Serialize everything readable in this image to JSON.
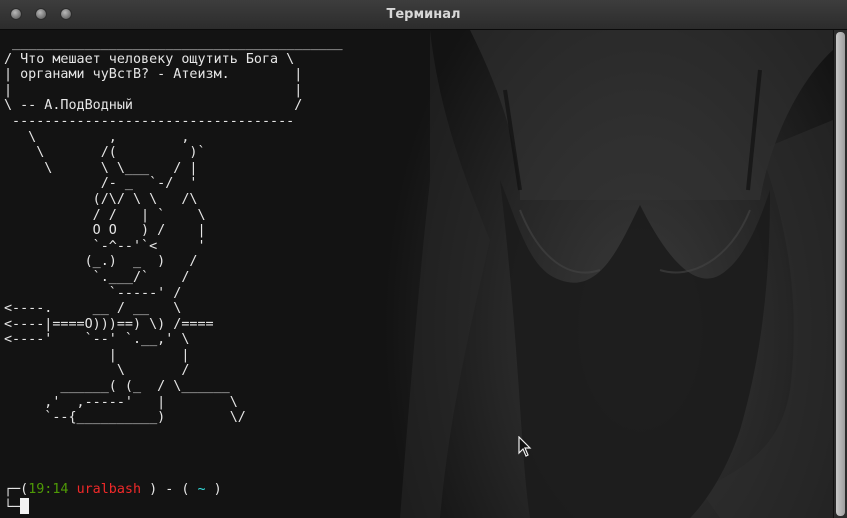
{
  "window": {
    "title": "Терминал",
    "buttons": [
      "close",
      "minimize",
      "maximize"
    ]
  },
  "terminal": {
    "output": " _________________________________________\n/ Что мешает человеку ощутить Бога \\\n| органами чуВстВ? - Атеизм.        |\n|                                   |\n\\ -- А.ПодВодный                    /\n -----------------------------------\n   \\         ,        ,\n    \\       /(         )`\n     \\      \\ \\___   / |\n            /- _  `-/  '\n           (/\\/ \\ \\   /\\\n           / /   | `    \\\n           O O   ) /    |\n           `-^--'`<     '\n          (_.)  _  )   /\n           `.___/`    /\n             `-----' /\n<----.     __ / __   \\\n<----|====O)))==) \\) /====\n<----'    `--' `.__,' \\\n             |        |\n              \\       /\n       ______( (_  / \\______\n     ,'  ,-----'   |        \\\n     `--{__________)        \\/",
    "prompt": {
      "open": "┌─(",
      "time": "19:14",
      "user": "uralbash",
      "sep": " ) - ( ",
      "dir": "~",
      "close": " )",
      "second_line": "└─"
    },
    "colors": {
      "time": "#4e9a06",
      "user": "#ef2929",
      "dir": "#34e2e2",
      "text": "#e6e6e6",
      "background": "#131313"
    }
  }
}
